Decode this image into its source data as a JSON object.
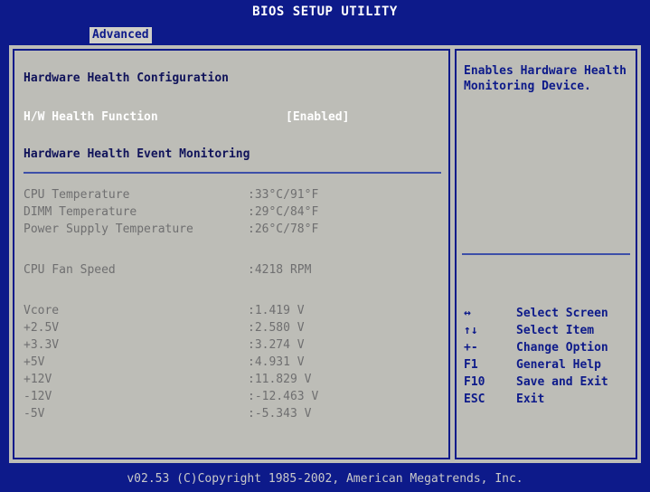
{
  "header": {
    "title": "BIOS SETUP UTILITY"
  },
  "tabs": {
    "active": "Advanced"
  },
  "main": {
    "section_title": "Hardware Health Configuration",
    "hw_health": {
      "label": "H/W Health Function",
      "value": "[Enabled]"
    },
    "event_title": "Hardware Health Event Monitoring",
    "temperatures": [
      {
        "label": "CPU Temperature",
        "value": ":33°C/91°F"
      },
      {
        "label": "DIMM Temperature",
        "value": ":29°C/84°F"
      },
      {
        "label": "Power Supply Temperature",
        "value": ":26°C/78°F"
      }
    ],
    "fan": {
      "label": "CPU Fan Speed",
      "value": ":4218 RPM"
    },
    "voltages": [
      {
        "label": "Vcore",
        "value": ":1.419 V"
      },
      {
        "label": "+2.5V",
        "value": ":2.580 V"
      },
      {
        "label": "+3.3V",
        "value": ":3.274 V"
      },
      {
        "label": "+5V",
        "value": ":4.931 V"
      },
      {
        "label": "+12V",
        "value": ":11.829 V"
      },
      {
        "label": "-12V",
        "value": ":-12.463 V"
      },
      {
        "label": "-5V",
        "value": ":-5.343 V"
      }
    ]
  },
  "help": {
    "text": "Enables Hardware Health Monitoring Device.",
    "keys": [
      {
        "key": "↔",
        "desc": "Select Screen"
      },
      {
        "key": "↑↓",
        "desc": "Select Item"
      },
      {
        "key": "+-",
        "desc": "Change Option"
      },
      {
        "key": "F1",
        "desc": "General Help"
      },
      {
        "key": "F10",
        "desc": "Save and Exit"
      },
      {
        "key": "ESC",
        "desc": "Exit"
      }
    ]
  },
  "footer": {
    "text": "v02.53 (C)Copyright 1985-2002, American Megatrends, Inc."
  },
  "colors": {
    "background": "#0d1a8a",
    "panel": "#bdbdb7",
    "highlight": "#ffffff",
    "disabled_text": "#6f6f70"
  }
}
